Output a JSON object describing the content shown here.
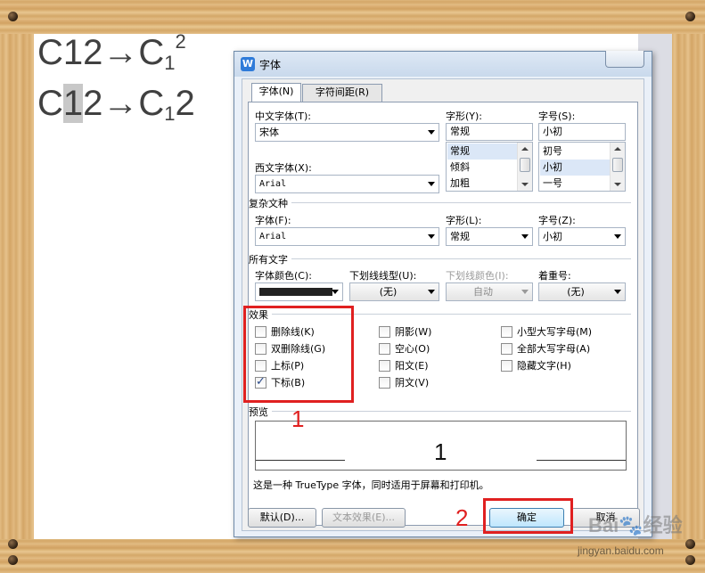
{
  "document": {
    "line1": {
      "prefix": "C12→C",
      "sub": "1",
      "sup": "2"
    },
    "line2": {
      "pre": "C",
      "highlight": "1",
      "mid": "2→C",
      "sub": "1",
      "post": "2"
    }
  },
  "dialog": {
    "title": "字体",
    "app_icon": "W",
    "tabs": [
      {
        "label": "字体(N)",
        "active": true
      },
      {
        "label": "字符间距(R)",
        "active": false
      }
    ],
    "chinese_font": {
      "label": "中文字体(T):",
      "value": "宋体"
    },
    "western_font": {
      "label": "西文字体(X):",
      "value": "Arial"
    },
    "style": {
      "label": "字形(Y):",
      "value": "常规",
      "options": [
        "常规",
        "倾斜",
        "加粗"
      ],
      "selected": "常规"
    },
    "size": {
      "label": "字号(S):",
      "value": "小初",
      "options": [
        "初号",
        "小初",
        "一号"
      ],
      "selected": "小初"
    },
    "complex": {
      "section": "复杂文种",
      "font_label": "字体(F):",
      "font_value": "Arial",
      "style_label": "字形(L):",
      "style_value": "常规",
      "size_label": "字号(Z):",
      "size_value": "小初"
    },
    "all_text": {
      "section": "所有文字",
      "color_label": "字体颜色(C):",
      "underline_label": "下划线线型(U):",
      "underline_value": "(无)",
      "underline_color_label": "下划线颜色(I):",
      "underline_color_value": "自动",
      "emphasis_label": "着重号:",
      "emphasis_value": "(无)",
      "font_color": "#222222"
    },
    "effects": {
      "section": "效果",
      "col1": [
        {
          "label": "删除线(K)",
          "checked": false
        },
        {
          "label": "双删除线(G)",
          "checked": false
        },
        {
          "label": "上标(P)",
          "checked": false
        },
        {
          "label": "下标(B)",
          "checked": true
        }
      ],
      "col2": [
        {
          "label": "阴影(W)",
          "checked": false
        },
        {
          "label": "空心(O)",
          "checked": false
        },
        {
          "label": "阳文(E)",
          "checked": false
        },
        {
          "label": "阴文(V)",
          "checked": false
        }
      ],
      "col3": [
        {
          "label": "小型大写字母(M)",
          "checked": false
        },
        {
          "label": "全部大写字母(A)",
          "checked": false
        },
        {
          "label": "隐藏文字(H)",
          "checked": false
        }
      ]
    },
    "preview": {
      "section": "预览",
      "sample": "1"
    },
    "footnote": "这是一种 TrueType 字体，同时适用于屏幕和打印机。",
    "buttons": {
      "default_label": "默认(D)...",
      "text_effect_label": "文本效果(E)...",
      "ok_label": "确定",
      "cancel_label": "取消"
    }
  },
  "annotations": {
    "marker1": "1",
    "marker2": "2",
    "color": "#e02020"
  },
  "watermark": {
    "brand": "Bai",
    "brand2": "经验",
    "url": "jingyan.baidu.com"
  }
}
